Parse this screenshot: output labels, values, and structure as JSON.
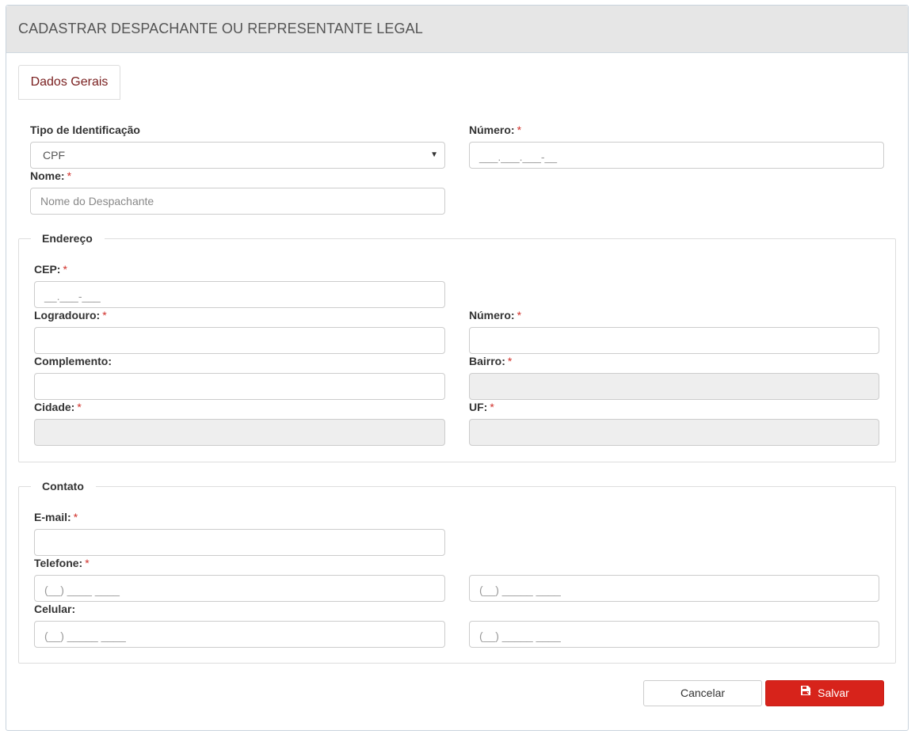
{
  "header": {
    "title": "CADASTRAR DESPACHANTE OU REPRESENTANTE LEGAL"
  },
  "tabs": [
    {
      "label": "Dados Gerais"
    }
  ],
  "general": {
    "id_type_label": "Tipo de Identificação",
    "id_type_value": "CPF",
    "number_label": "Número:",
    "number_mask": "___.___.___-__",
    "name_label": "Nome:",
    "name_placeholder": "Nome do Despachante"
  },
  "address": {
    "legend": "Endereço",
    "cep_label": "CEP:",
    "cep_mask": "__.___-___",
    "street_label": "Logradouro:",
    "number_label": "Número:",
    "complement_label": "Complemento:",
    "district_label": "Bairro:",
    "city_label": "Cidade:",
    "state_label": "UF:"
  },
  "contact": {
    "legend": "Contato",
    "email_label": "E-mail:",
    "phone_label": "Telefone:",
    "phone_mask_1": "(__) ____ ____",
    "phone_mask_2": "(__) _____ ____",
    "mobile_label": "Celular:",
    "mobile_mask_1": "(__) _____ ____",
    "mobile_mask_2": "(__) _____ ____"
  },
  "required_marker": "*",
  "actions": {
    "cancel": "Cancelar",
    "save": "Salvar"
  },
  "colors": {
    "accent": "#d7231b",
    "tab_text": "#7a2020",
    "header_bg": "#e6e6e6"
  },
  "icons": {
    "save": "save-icon",
    "caret": "caret-down-icon"
  }
}
